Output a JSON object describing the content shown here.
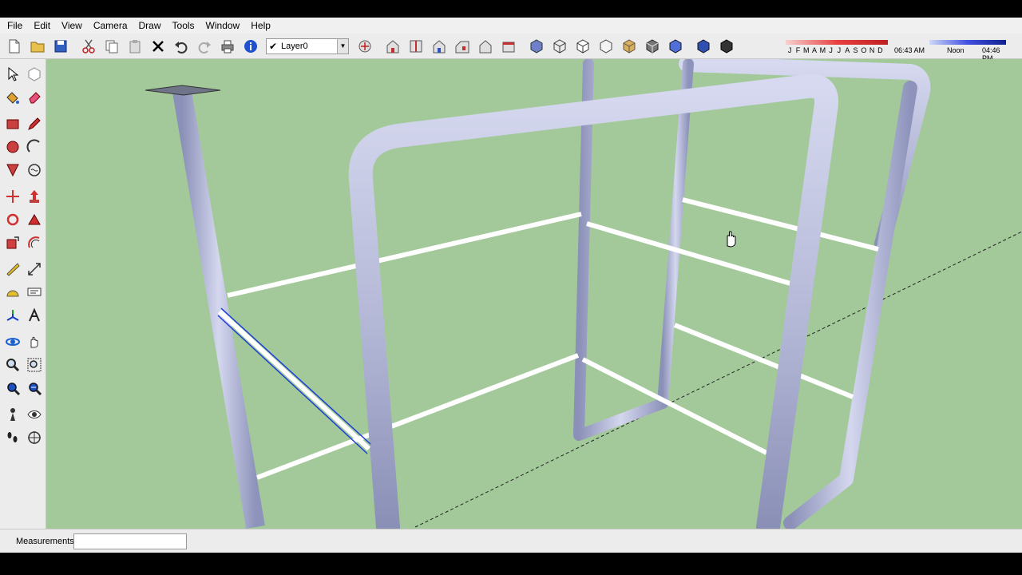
{
  "menu": [
    "File",
    "Edit",
    "View",
    "Camera",
    "Draw",
    "Tools",
    "Window",
    "Help"
  ],
  "toolbar": {
    "layer_checked": "✔",
    "layer_name": "Layer0",
    "layer_arrow": "▼"
  },
  "shadow": {
    "months": [
      "J",
      "F",
      "M",
      "A",
      "M",
      "J",
      "J",
      "A",
      "S",
      "O",
      "N",
      "D"
    ],
    "time_start": "06:43 AM",
    "time_noon": "Noon",
    "time_end": "04:46 PM"
  },
  "status": {
    "measurements_label": "Measurements",
    "measurements_value": ""
  },
  "colors": {
    "viewport_bg": "#a3c99a",
    "pipe_fill": "#b8bcd8",
    "rail_fill": "#ffffff",
    "selection": "#1a3cd8"
  }
}
